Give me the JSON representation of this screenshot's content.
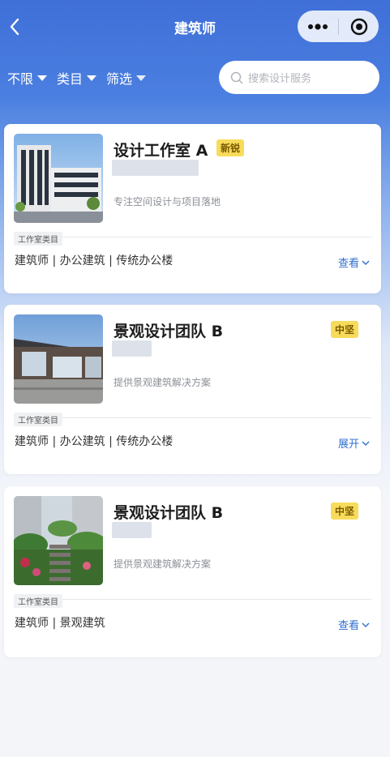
{
  "header": {
    "title": "建筑师",
    "back_icon": "chevron-left-icon",
    "more_icon": "more-dots-icon",
    "close_icon": "target-close-icon"
  },
  "filters": [
    {
      "label": "不限"
    },
    {
      "label": "类目"
    },
    {
      "label": "筛选"
    }
  ],
  "search": {
    "placeholder": "搜索设计服务"
  },
  "cards": [
    {
      "name": "设计工作室 A",
      "badge": "新锐",
      "description": "专注空间设计与项目落地",
      "category_label": "工作室类目",
      "tags": "建筑师 | 办公建筑 | 传统办公楼",
      "action": "查看"
    },
    {
      "name": "景观设计团队 B",
      "badge": "中坚",
      "description": "提供景观建筑解决方案",
      "category_label": "工作室类目",
      "tags": "建筑师 | 办公建筑 | 传统办公楼",
      "action": "展开"
    },
    {
      "name": "景观设计团队 B",
      "badge": "中坚",
      "description": "提供景观建筑解决方案",
      "category_label": "工作室类目",
      "tags": "建筑师 | 景观建筑",
      "action": "查看"
    }
  ],
  "colors": {
    "header_blue": "#4277db",
    "badge_yellow": "#f7dc5b",
    "link_blue": "#2f6fd1"
  }
}
